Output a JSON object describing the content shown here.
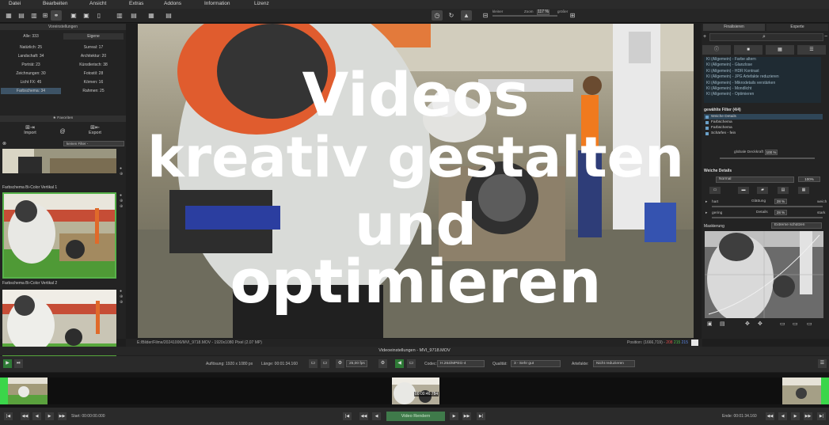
{
  "menu": [
    "Datei",
    "Bearbeiten",
    "Ansicht",
    "Extras",
    "Addons",
    "Information",
    "Lizenz"
  ],
  "toolbar": {
    "zoom_small_label": "kleiner",
    "zoom_label": "Zoom",
    "zoom_value": "117 %",
    "zoom_large_label": "größer"
  },
  "left": {
    "header": "Voreinstellungen",
    "presets": [
      [
        "Alle: 333",
        "Eigene"
      ],
      [
        "Natürlich: 25",
        "Surreal: 17"
      ],
      [
        "Landschaft: 34",
        "Architektur: 20"
      ],
      [
        "Porträt: 23",
        "Künstlerisch: 38"
      ],
      [
        "Zeichnungen: 30",
        "Fotostil: 28"
      ],
      [
        "Licht FX: 45",
        "Körnen: 16"
      ],
      [
        "Farbschema: 34",
        "Rahmen: 25"
      ]
    ],
    "favorites": "★ Favoriten",
    "import_label": "Import",
    "export_label": "Export",
    "filter_placeholder": "keinen Filter -",
    "thumb1_title": "Farbschema Bi-Color Vertikal 1",
    "thumb2_title": "Farbschema Bi-Color Vertikal 2"
  },
  "overlay": {
    "lines": [
      "Videos",
      "kreativ gestalten",
      "und",
      "optimieren"
    ]
  },
  "pathbar": {
    "path": "E:/Bilder/Filme/20241006/MVI_9718.MOV - 1920x1080 Pixel (2.07 MP)",
    "position_label": "Position: (1666,719) -",
    "r": "208",
    "g": "215",
    "b": "215"
  },
  "right": {
    "tab_finalisieren": "Finalisieren",
    "tab_experte": "Experte",
    "filter_list": [
      "KI (Allgemein) - Farbe altern",
      "KI (Allgemein) - Glanzlose",
      "KI (Allgemein) - HDR Kontrast",
      "KI (Allgemein) - JPG Artefakte reduzieren",
      "KI (Allgemein) - Mikrodetails verstärken",
      "KI (Allgemein) - Mondlicht",
      "KI (Allgemein) - Optimieren"
    ],
    "selected_filters_title": "gewählte Filter (4/4)",
    "selected_filters": [
      "Weiche Details",
      "Farbschema",
      "Farbschema",
      "Schärfen - fein"
    ],
    "global_opacity_label": "globale Deckkraft",
    "global_opacity_value": "100 %",
    "weiche_title": "Weiche Details",
    "blend_mode": "Normal",
    "blend_value": "100%",
    "glaettung_label": "Glättung",
    "glaettung_value": "28 %",
    "hart_label": "hart",
    "weich_label": "weich",
    "details_label": "Details",
    "details_value": "28 %",
    "gering_label": "gering",
    "stark_label": "stark",
    "maskierung_label": "Maskierung",
    "maskierung_select": "Extreme schützen"
  },
  "bottom": {
    "title": "Videoeinstellungen - MVI_9718.MOV",
    "aufloesung": "Auflösung: 1920 x 1080 px",
    "laenge": "Länge: 00:01:34.160",
    "fps": "25,00 fps",
    "codec_label": "Codec:",
    "codec_value": "H.264/MPEG-4",
    "qualitaet_label": "Qualität:",
    "qualitaet_value": "3 - Sehr gut",
    "artefakte_label": "Artefakte:",
    "artefakte_value": "Nicht reduzieren",
    "clip_time": "00:00:46.784",
    "start_label": "Start: 00:00:00.000",
    "render_label": "Video Rendern",
    "end_label": "Ende: 00:01:34.160"
  }
}
